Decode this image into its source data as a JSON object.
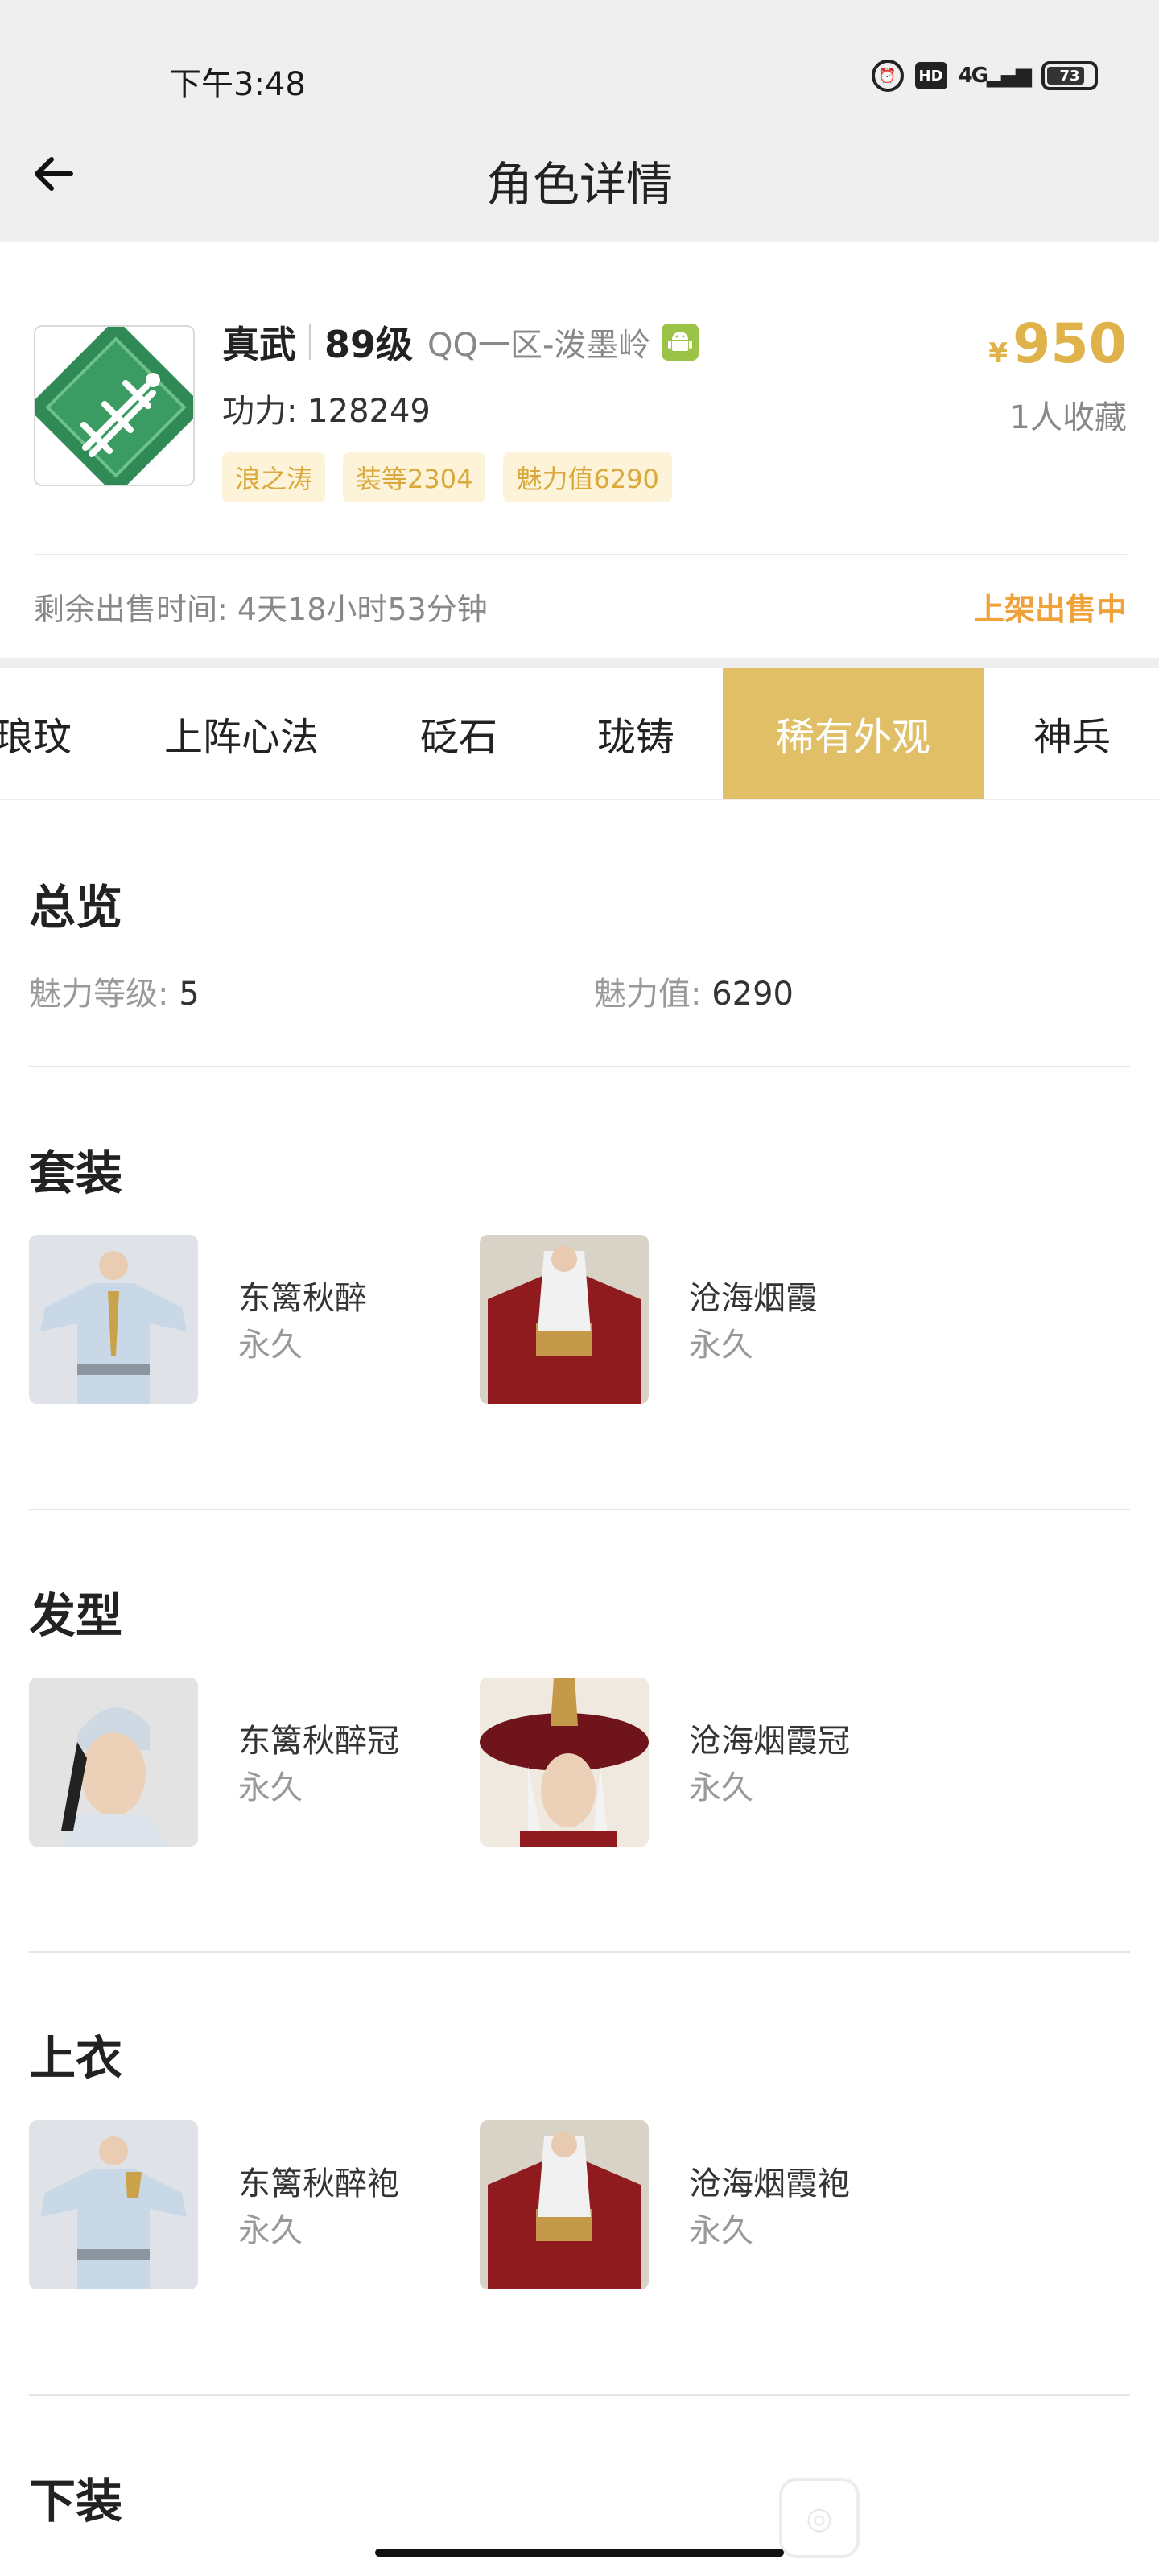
{
  "status_bar": {
    "time": "下午3:48",
    "icons": [
      "alarm-icon",
      "hd-icon",
      "4g-signal-icon",
      "battery-icon"
    ],
    "hd_text": "HD",
    "network_text": "4G",
    "battery_level": "73"
  },
  "header": {
    "back_icon": "arrow-left-icon",
    "title": "角色详情"
  },
  "role": {
    "school": "真武",
    "level": "89级",
    "server": "QQ一区-泼墨岭",
    "platform_icon": "android-icon",
    "power_label": "功力: 128249",
    "tags": [
      "浪之涛",
      "装等2304",
      "魅力值6290"
    ],
    "price_symbol": "¥",
    "price": "950",
    "favorites": "1人收藏",
    "remaining_time": "剩余出售时间: 4天18小时53分钟",
    "sale_status": "上架出售中",
    "accent_color": "#e1bf67"
  },
  "tabs": [
    "琅玟",
    "上阵心法",
    "砭石",
    "珑铸",
    "稀有外观",
    "神兵"
  ],
  "active_tab": "稀有外观",
  "overview": {
    "title": "总览",
    "charm_level_label": "魅力等级:",
    "charm_level_value": "5",
    "charm_value_label": "魅力值:",
    "charm_value_value": "6290"
  },
  "sections": [
    {
      "title": "套装",
      "items": [
        {
          "name": "东篱秋醉",
          "duration": "永久"
        },
        {
          "name": "沧海烟霞",
          "duration": "永久"
        }
      ]
    },
    {
      "title": "发型",
      "items": [
        {
          "name": "东篱秋醉冠",
          "duration": "永久"
        },
        {
          "name": "沧海烟霞冠",
          "duration": "永久"
        }
      ]
    },
    {
      "title": "上衣",
      "items": [
        {
          "name": "东篱秋醉袍",
          "duration": "永久"
        },
        {
          "name": "沧海烟霞袍",
          "duration": "永久"
        }
      ]
    },
    {
      "title": "下装",
      "items": []
    }
  ]
}
